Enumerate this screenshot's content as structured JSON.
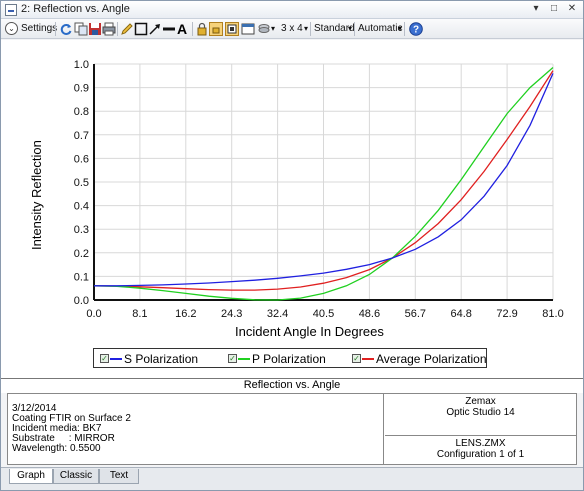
{
  "window": {
    "title": "2: Reflection vs. Angle"
  },
  "toolbar": {
    "settings_label": "Settings",
    "layout_label": "3 x 4",
    "mode_label": "Standard",
    "scale_label": "Automatic"
  },
  "chart_data": {
    "type": "line",
    "title": "Reflection vs. Angle",
    "xlabel": "Incident Angle In Degrees",
    "ylabel": "Intensity Reflection",
    "xlim": [
      0,
      81
    ],
    "ylim": [
      0,
      1
    ],
    "xticks": [
      "0.0",
      "8.1",
      "16.2",
      "24.3",
      "32.4",
      "40.5",
      "48.6",
      "56.7",
      "64.8",
      "72.9",
      "81.0"
    ],
    "yticks": [
      "0.0",
      "0.1",
      "0.2",
      "0.3",
      "0.4",
      "0.5",
      "0.6",
      "0.7",
      "0.8",
      "0.9",
      "1.0"
    ],
    "x": [
      0,
      4.05,
      8.1,
      12.15,
      16.2,
      20.25,
      24.3,
      28.35,
      32.4,
      36.45,
      40.5,
      44.55,
      48.6,
      52.65,
      56.7,
      60.75,
      64.8,
      68.85,
      72.9,
      76.95,
      81.0
    ],
    "series": [
      {
        "name": "S Polarization",
        "color": "#2020e0",
        "values": [
          0.06,
          0.06,
          0.062,
          0.064,
          0.068,
          0.072,
          0.078,
          0.084,
          0.092,
          0.102,
          0.114,
          0.13,
          0.15,
          0.178,
          0.215,
          0.268,
          0.34,
          0.44,
          0.57,
          0.74,
          0.96
        ]
      },
      {
        "name": "P Polarization",
        "color": "#20d020",
        "values": [
          0.06,
          0.058,
          0.05,
          0.04,
          0.028,
          0.016,
          0.007,
          0.001,
          0.0,
          0.008,
          0.028,
          0.06,
          0.108,
          0.178,
          0.27,
          0.38,
          0.51,
          0.65,
          0.79,
          0.9,
          0.985
        ]
      },
      {
        "name": "Average Polarization",
        "color": "#e02020",
        "values": [
          0.06,
          0.059,
          0.056,
          0.052,
          0.048,
          0.044,
          0.042,
          0.042,
          0.046,
          0.055,
          0.071,
          0.095,
          0.129,
          0.178,
          0.243,
          0.324,
          0.425,
          0.545,
          0.68,
          0.82,
          0.972
        ]
      }
    ]
  },
  "info": {
    "title": "Reflection vs. Angle",
    "left_lines": [
      "3/12/2014",
      "Coating FTIR on Surface 2",
      "Incident media: BK7",
      "Substrate     : MIRROR",
      "Wavelength: 0.5500"
    ],
    "right_top_lines": [
      "Zemax",
      "Optic Studio 14"
    ],
    "right_bottom_lines": [
      "LENS.ZMX",
      "Configuration 1 of 1"
    ]
  },
  "tabs": [
    "Graph",
    "Classic",
    "Text"
  ],
  "colors": {
    "accent": "#3a6fb0"
  }
}
